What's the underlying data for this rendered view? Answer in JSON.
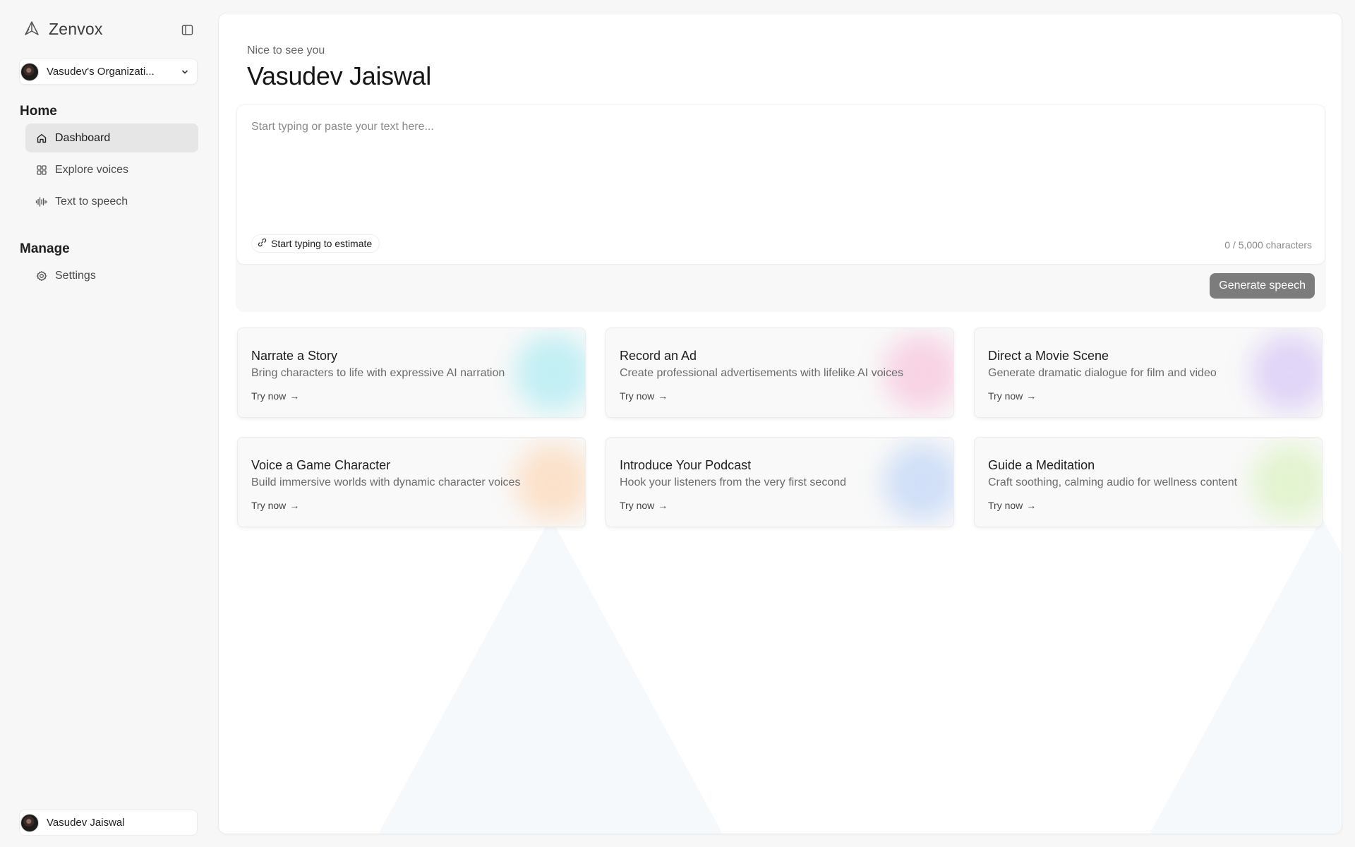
{
  "app": {
    "name": "Zenvox"
  },
  "org": {
    "name": "Vasudev's Organizati..."
  },
  "nav": {
    "home_title": "Home",
    "manage_title": "Manage",
    "items": [
      {
        "label": "Dashboard",
        "icon": "home-icon",
        "active": true
      },
      {
        "label": "Explore voices",
        "icon": "grid-icon",
        "active": false
      },
      {
        "label": "Text to speech",
        "icon": "waveform-icon",
        "active": false
      }
    ],
    "manage_items": [
      {
        "label": "Settings",
        "icon": "gear-icon"
      }
    ]
  },
  "user": {
    "name": "Vasudev Jaiswal"
  },
  "greeting": {
    "subtitle": "Nice to see you",
    "name": "Vasudev Jaiswal"
  },
  "composer": {
    "placeholder": "Start typing or paste your text here...",
    "estimate_label": "Start typing to estimate",
    "char_count": "0 / 5,000 characters",
    "generate_label": "Generate speech"
  },
  "cards": [
    {
      "title": "Narrate a Story",
      "desc": "Bring characters to life with expressive AI narration",
      "cta": "Try now",
      "accent": "#7fe3ef"
    },
    {
      "title": "Record an Ad",
      "desc": "Create professional advertisements with lifelike AI voices",
      "cta": "Try now",
      "accent": "#f7a6cc"
    },
    {
      "title": "Direct a Movie Scene",
      "desc": "Generate dramatic dialogue for film and video",
      "cta": "Try now",
      "accent": "#c3a8f5"
    },
    {
      "title": "Voice a Game Character",
      "desc": "Build immersive worlds with dynamic character voices",
      "cta": "Try now",
      "accent": "#ffc592"
    },
    {
      "title": "Introduce Your Podcast",
      "desc": "Hook your listeners from the very first second",
      "cta": "Try now",
      "accent": "#9fc0f5"
    },
    {
      "title": "Guide a Meditation",
      "desc": "Craft soothing, calming audio for wellness content",
      "cta": "Try now",
      "accent": "#c9ee9f"
    }
  ],
  "colors": {
    "primary_button": "#7c7c7c",
    "active_nav": "#e6e6e6",
    "background": "#f7f7f7"
  }
}
